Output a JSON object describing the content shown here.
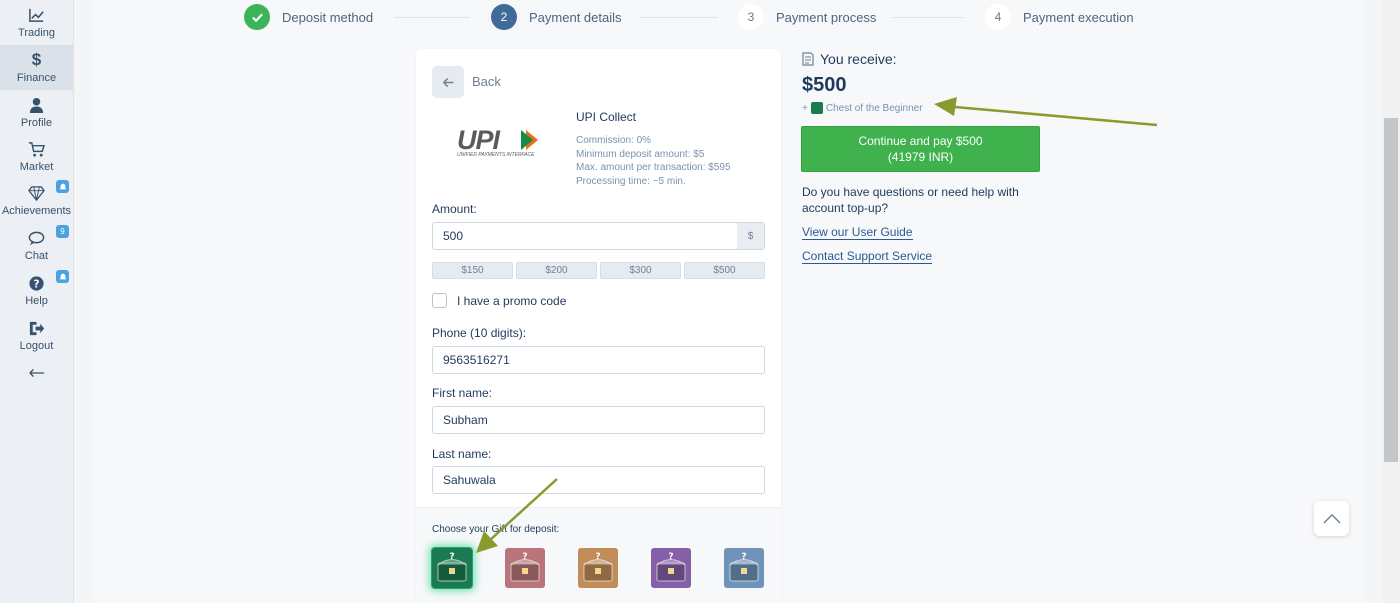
{
  "sidebar": {
    "items": [
      {
        "label": "Trading",
        "icon": "chart-line-icon"
      },
      {
        "label": "Finance",
        "icon": "dollar-icon"
      },
      {
        "label": "Profile",
        "icon": "user-icon"
      },
      {
        "label": "Market",
        "icon": "cart-icon"
      },
      {
        "label": "Achievements",
        "icon": "diamond-icon",
        "badge_icon": "bell-icon"
      },
      {
        "label": "Chat",
        "icon": "chat-icon",
        "badge": "9"
      },
      {
        "label": "Help",
        "icon": "question-icon",
        "badge_icon": "bell-icon"
      },
      {
        "label": "Logout",
        "icon": "logout-icon"
      }
    ],
    "active": "Finance",
    "collapse_icon": "arrow-left-icon"
  },
  "steps": [
    {
      "number": "",
      "label": "Deposit method",
      "state": "done"
    },
    {
      "number": "2",
      "label": "Payment details",
      "state": "current"
    },
    {
      "number": "3",
      "label": "Payment process",
      "state": "upcoming"
    },
    {
      "number": "4",
      "label": "Payment execution",
      "state": "upcoming"
    }
  ],
  "card": {
    "back_label": "Back",
    "method": {
      "logo_text": "UPI",
      "logo_subtitle": "UNIFIED PAYMENTS INTERFACE",
      "title": "UPI Collect",
      "commission": "Commission: 0%",
      "min_deposit": "Minimum deposit amount: $5",
      "max_amount": "Max. amount per transaction: $595",
      "processing": "Processing time: ~5 min."
    },
    "amount_label": "Amount:",
    "amount_value": "500",
    "currency_symbol": "$",
    "quick_amounts": [
      "$150",
      "$200",
      "$300",
      "$500"
    ],
    "promo_label": "I have a promo code",
    "promo_checked": false,
    "phone_label": "Phone (10 digits):",
    "phone_value": "9563516271",
    "first_name_label": "First name:",
    "first_name_value": "Subham",
    "last_name_label": "Last name:",
    "last_name_value": "Sahuwala",
    "gift_label": "Choose your Gift for deposit:",
    "gifts": [
      {
        "name": "green-chest",
        "color": "#1b7a52",
        "selected": true
      },
      {
        "name": "pink-chest",
        "color": "#b9757a",
        "selected": false
      },
      {
        "name": "orange-chest",
        "color": "#c08d5a",
        "selected": false
      },
      {
        "name": "purple-chest",
        "color": "#8560a8",
        "selected": false
      },
      {
        "name": "blue-chest",
        "color": "#6f93b9",
        "selected": false
      }
    ]
  },
  "receive": {
    "label": "You receive:",
    "amount": "$500",
    "bonus_prefix": "+",
    "bonus": "Chest of the Beginner",
    "pay_button_line1": "Continue and pay $500",
    "pay_button_line2": "(41979 INR)",
    "help_text": "Do you have questions or need help with account top-up?",
    "link_guide": "View our User Guide",
    "link_support": "Contact Support Service"
  },
  "colors": {
    "accent_green": "#3fb24e",
    "step_current": "#3e6b98",
    "annotation_arrow": "#8a9a2c"
  }
}
